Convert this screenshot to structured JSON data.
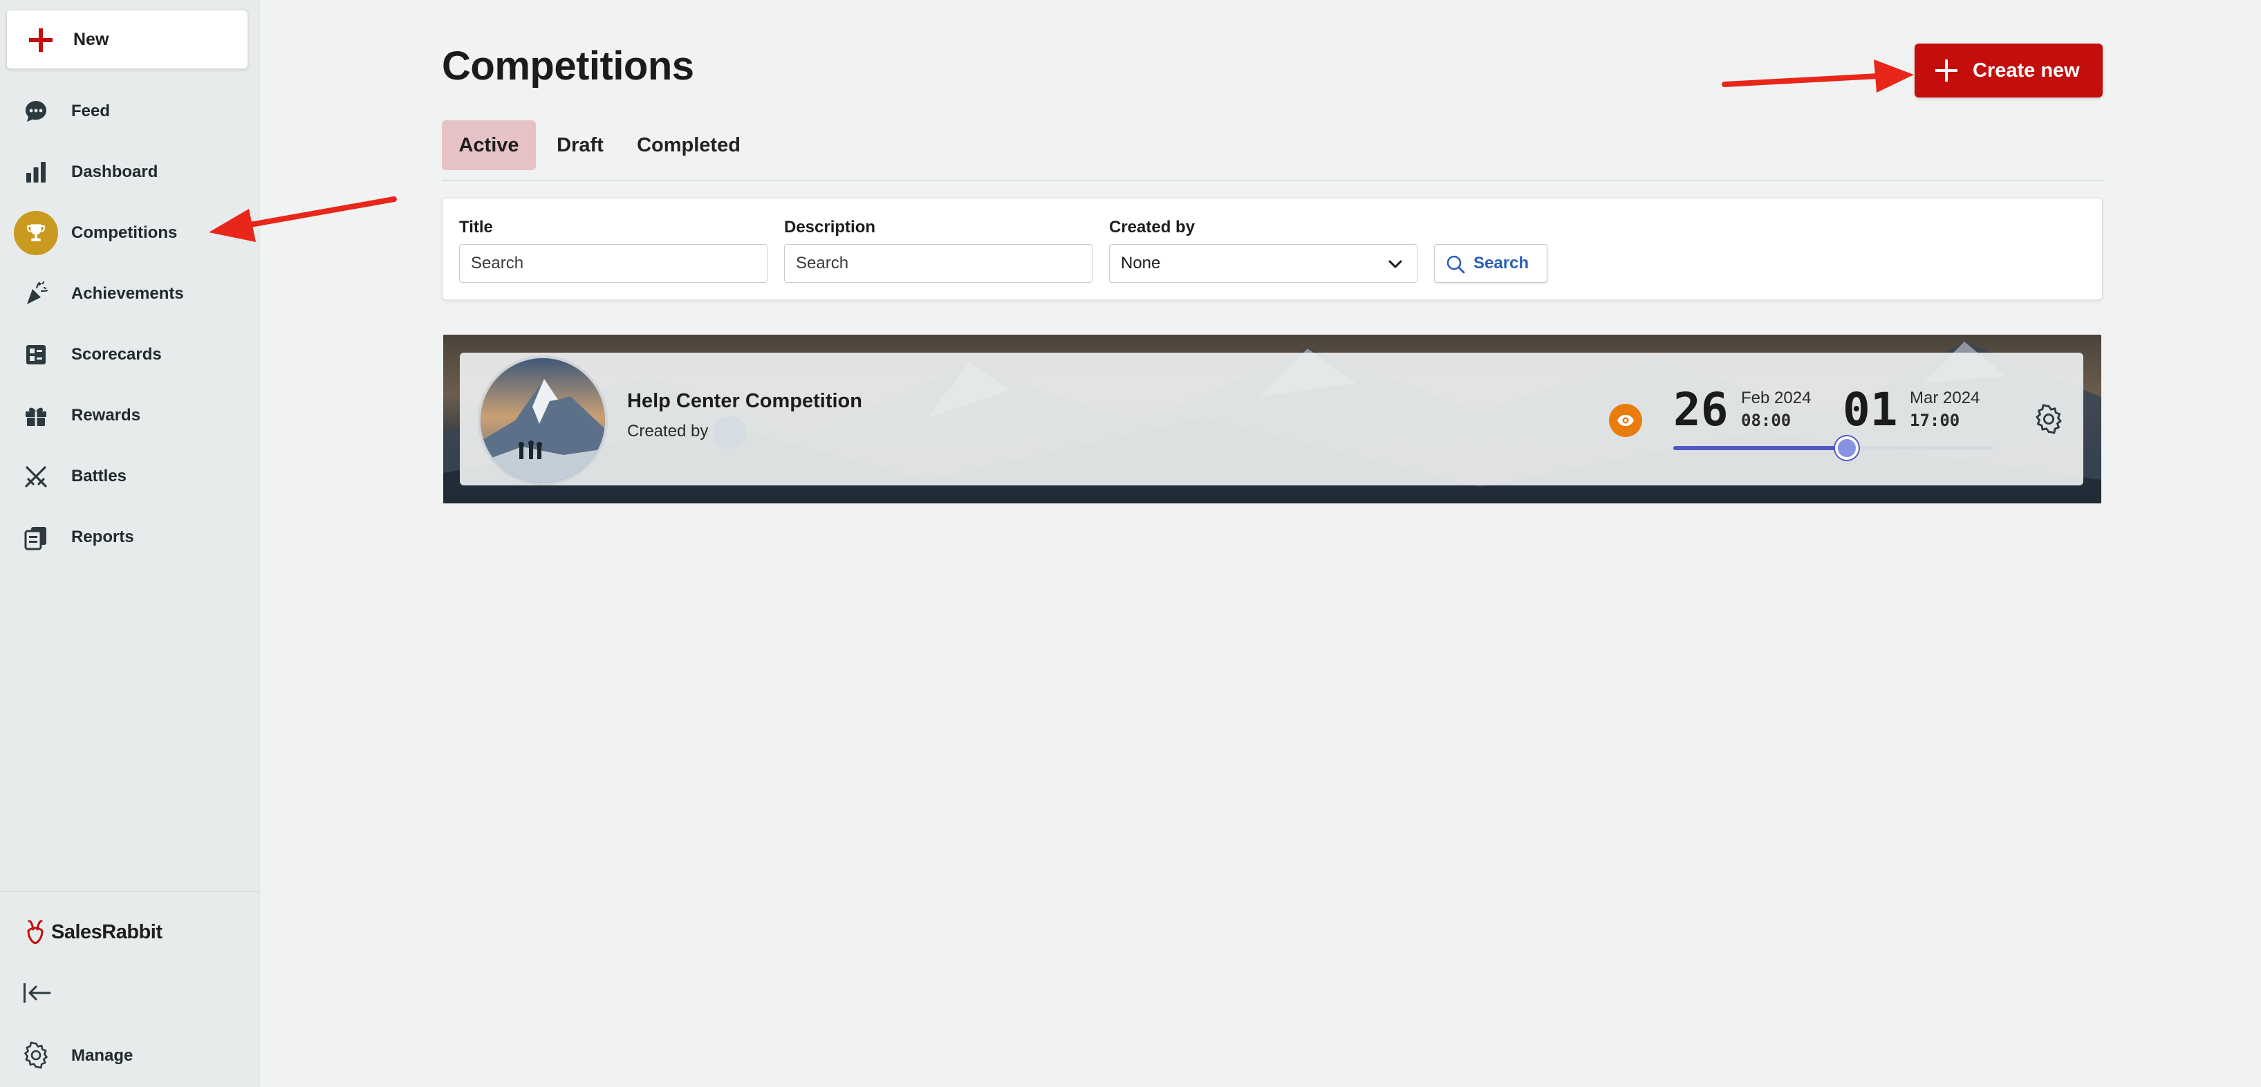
{
  "sidebar": {
    "new_label": "New",
    "items": [
      {
        "id": "feed",
        "label": "Feed",
        "icon": "chat-bubble-icon"
      },
      {
        "id": "dashboard",
        "label": "Dashboard",
        "icon": "bar-chart-icon"
      },
      {
        "id": "competitions",
        "label": "Competitions",
        "icon": "trophy-icon",
        "active": true
      },
      {
        "id": "achievements",
        "label": "Achievements",
        "icon": "party-popper-icon"
      },
      {
        "id": "scorecards",
        "label": "Scorecards",
        "icon": "scorecard-icon"
      },
      {
        "id": "rewards",
        "label": "Rewards",
        "icon": "gift-icon"
      },
      {
        "id": "battles",
        "label": "Battles",
        "icon": "crossed-swords-icon"
      },
      {
        "id": "reports",
        "label": "Reports",
        "icon": "reports-icon"
      }
    ],
    "brand": "SalesRabbit",
    "manage_label": "Manage"
  },
  "main": {
    "title": "Competitions",
    "create_label": "Create new",
    "tabs": [
      {
        "label": "Active",
        "active": true
      },
      {
        "label": "Draft",
        "active": false
      },
      {
        "label": "Completed",
        "active": false
      }
    ],
    "filters": {
      "title_label": "Title",
      "title_placeholder": "Search",
      "description_label": "Description",
      "description_placeholder": "Search",
      "created_by_label": "Created by",
      "created_by_value": "None",
      "search_label": "Search"
    },
    "competition": {
      "title": "Help Center Competition",
      "created_by_label": "Created by",
      "start_day": "26",
      "start_month_year": "Feb 2024",
      "start_time": "08:00",
      "end_day": "01",
      "end_month_year": "Mar 2024",
      "end_time": "17:00",
      "progress": 0.54
    }
  },
  "colors": {
    "accent_red": "#c40d0d",
    "active_tab_bg": "#e6c1c5",
    "active_nav_gold": "#c99a1f",
    "eye_orange": "#e87c0c",
    "progress_blue": "#5159c2",
    "annotation_arrow": "#e8261a"
  }
}
